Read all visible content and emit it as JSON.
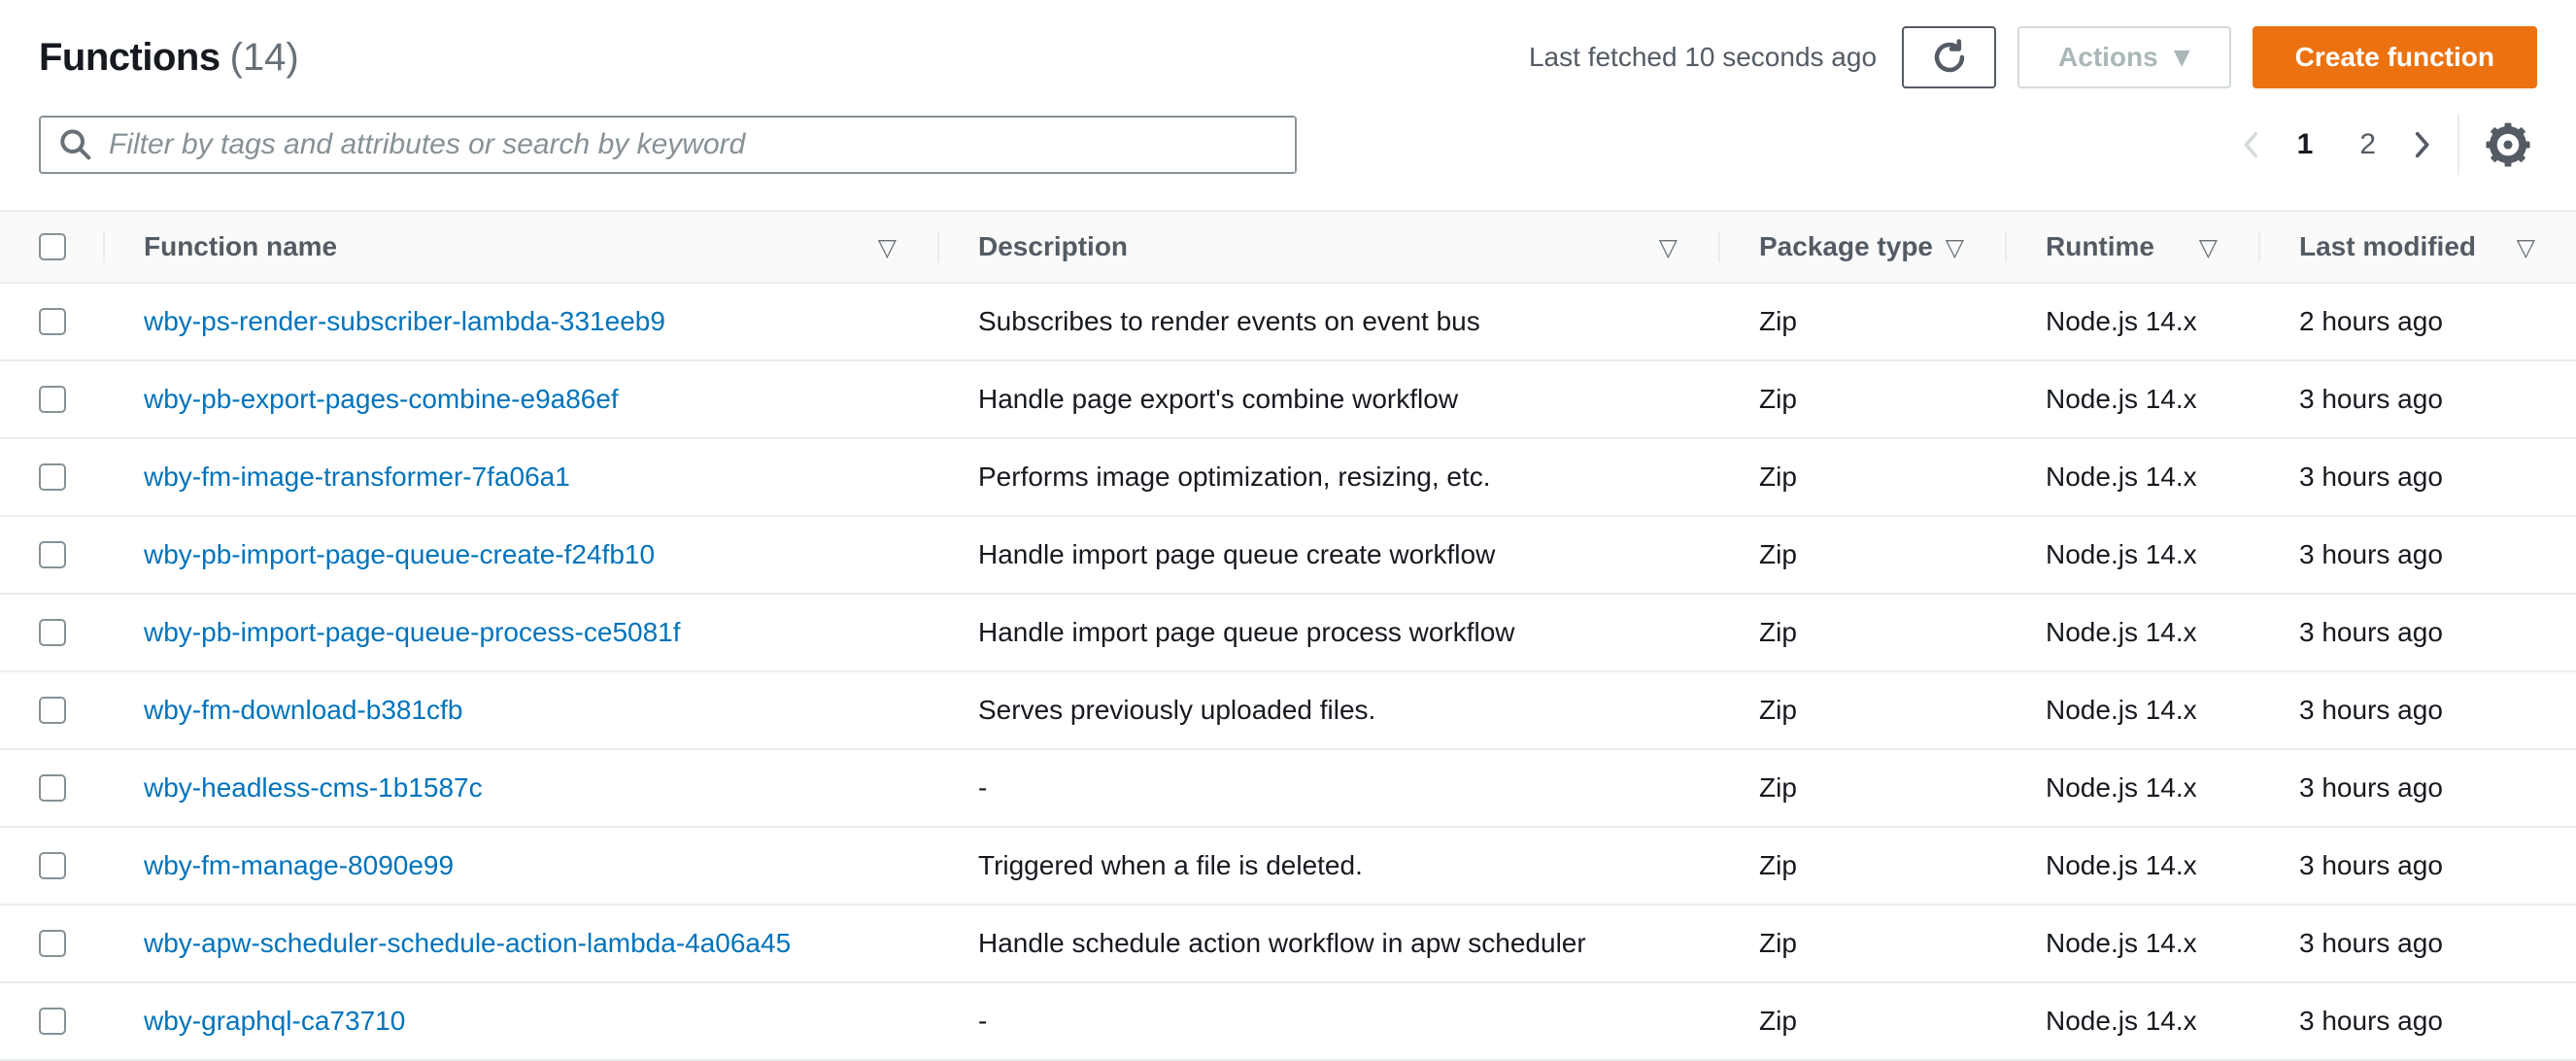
{
  "page": {
    "title": "Functions",
    "count": "(14)"
  },
  "header_actions": {
    "last_fetched": "Last fetched 10 seconds ago",
    "actions_label": "Actions",
    "create_label": "Create function"
  },
  "search": {
    "placeholder": "Filter by tags and attributes or search by keyword",
    "value": ""
  },
  "pagination": {
    "current_page": "1",
    "next_page": "2"
  },
  "icons": {
    "sort": "▽",
    "caret_down": "▼",
    "search": "magnifier",
    "refresh": "circular-arrow",
    "gear": "settings-gear",
    "chevron_left": "angle-left",
    "chevron_right": "angle-right"
  },
  "colors": {
    "accent_orange": "#ec7211",
    "link_blue": "#0073bb",
    "header_bg": "#fafafa",
    "row_border": "#eaeded",
    "text_primary": "#16191f",
    "text_secondary": "#545b64",
    "disabled_gray": "#aab7b8"
  },
  "table": {
    "columns": [
      "Function name",
      "Description",
      "Package type",
      "Runtime",
      "Last modified"
    ],
    "rows": [
      {
        "name": "wby-ps-render-subscriber-lambda-331eeb9",
        "description": "Subscribes to render events on event bus",
        "package_type": "Zip",
        "runtime": "Node.js 14.x",
        "last_modified": "2 hours ago"
      },
      {
        "name": "wby-pb-export-pages-combine-e9a86ef",
        "description": "Handle page export's combine workflow",
        "package_type": "Zip",
        "runtime": "Node.js 14.x",
        "last_modified": "3 hours ago"
      },
      {
        "name": "wby-fm-image-transformer-7fa06a1",
        "description": "Performs image optimization, resizing, etc.",
        "package_type": "Zip",
        "runtime": "Node.js 14.x",
        "last_modified": "3 hours ago"
      },
      {
        "name": "wby-pb-import-page-queue-create-f24fb10",
        "description": "Handle import page queue create workflow",
        "package_type": "Zip",
        "runtime": "Node.js 14.x",
        "last_modified": "3 hours ago"
      },
      {
        "name": "wby-pb-import-page-queue-process-ce5081f",
        "description": "Handle import page queue process workflow",
        "package_type": "Zip",
        "runtime": "Node.js 14.x",
        "last_modified": "3 hours ago"
      },
      {
        "name": "wby-fm-download-b381cfb",
        "description": "Serves previously uploaded files.",
        "package_type": "Zip",
        "runtime": "Node.js 14.x",
        "last_modified": "3 hours ago"
      },
      {
        "name": "wby-headless-cms-1b1587c",
        "description": "-",
        "package_type": "Zip",
        "runtime": "Node.js 14.x",
        "last_modified": "3 hours ago"
      },
      {
        "name": "wby-fm-manage-8090e99",
        "description": "Triggered when a file is deleted.",
        "package_type": "Zip",
        "runtime": "Node.js 14.x",
        "last_modified": "3 hours ago"
      },
      {
        "name": "wby-apw-scheduler-schedule-action-lambda-4a06a45",
        "description": "Handle schedule action workflow in apw scheduler",
        "package_type": "Zip",
        "runtime": "Node.js 14.x",
        "last_modified": "3 hours ago"
      },
      {
        "name": "wby-graphql-ca73710",
        "description": "-",
        "package_type": "Zip",
        "runtime": "Node.js 14.x",
        "last_modified": "3 hours ago"
      }
    ]
  }
}
